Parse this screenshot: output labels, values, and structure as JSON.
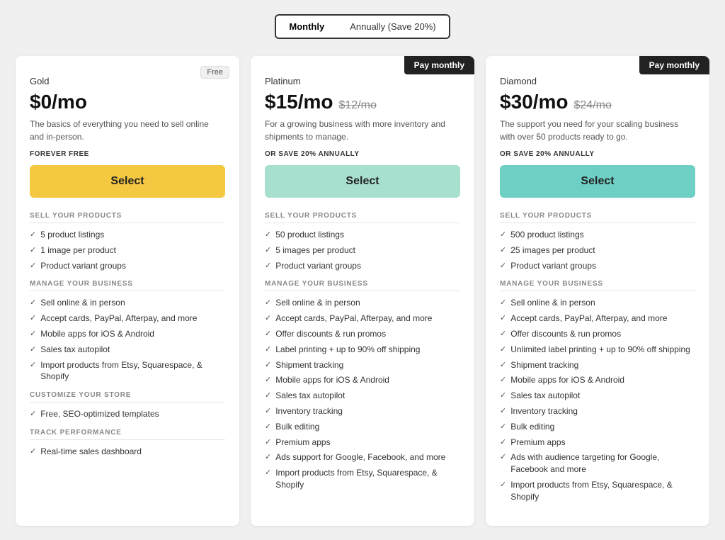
{
  "billing_toggle": {
    "monthly_label": "Monthly",
    "annually_label": "Annually (Save 20%)",
    "active": "monthly"
  },
  "plans": [
    {
      "id": "gold",
      "name": "Gold",
      "badge": "Free",
      "badge_type": "free",
      "price_main": "$0/mo",
      "price_original": null,
      "top_button": null,
      "description": "The basics of everything you need to sell online and in-person.",
      "sub_label": "FOREVER FREE",
      "select_label": "Select",
      "select_style": "gold",
      "sections": [
        {
          "title": "SELL YOUR PRODUCTS",
          "items": [
            "5 product listings",
            "1 image per product",
            "Product variant groups"
          ]
        },
        {
          "title": "MANAGE YOUR BUSINESS",
          "items": [
            "Sell online & in person",
            "Accept cards, PayPal, Afterpay, and more",
            "Mobile apps for iOS & Android",
            "Sales tax autopilot",
            "Import products from Etsy, Squarespace, & Shopify"
          ]
        },
        {
          "title": "CUSTOMIZE YOUR STORE",
          "items": [
            "Free, SEO-optimized templates"
          ]
        },
        {
          "title": "TRACK PERFORMANCE",
          "items": [
            "Real-time sales dashboard"
          ]
        }
      ]
    },
    {
      "id": "platinum",
      "name": "Platinum",
      "badge": null,
      "badge_type": null,
      "price_main": "$15/mo",
      "price_original": "$12/mo",
      "top_button": "Pay monthly",
      "description": "For a growing business with more inventory and shipments to manage.",
      "sub_label": "OR SAVE 20% ANNUALLY",
      "select_label": "Select",
      "select_style": "platinum",
      "sections": [
        {
          "title": "SELL YOUR PRODUCTS",
          "items": [
            "50 product listings",
            "5 images per product",
            "Product variant groups"
          ]
        },
        {
          "title": "MANAGE YOUR BUSINESS",
          "items": [
            "Sell online & in person",
            "Accept cards, PayPal, Afterpay, and more",
            "Offer discounts & run promos",
            "Label printing + up to 90% off shipping",
            "Shipment tracking",
            "Mobile apps for iOS & Android",
            "Sales tax autopilot",
            "Inventory tracking",
            "Bulk editing",
            "Premium apps",
            "Ads support for Google, Facebook, and more",
            "Import products from Etsy, Squarespace, & Shopify"
          ]
        }
      ]
    },
    {
      "id": "diamond",
      "name": "Diamond",
      "badge": null,
      "badge_type": null,
      "price_main": "$30/mo",
      "price_original": "$24/mo",
      "top_button": "Pay monthly",
      "description": "The support you need for your scaling business with over 50 products ready to go.",
      "sub_label": "OR SAVE 20% ANNUALLY",
      "select_label": "Select",
      "select_style": "diamond",
      "sections": [
        {
          "title": "SELL YOUR PRODUCTS",
          "items": [
            "500 product listings",
            "25 images per product",
            "Product variant groups"
          ]
        },
        {
          "title": "MANAGE YOUR BUSINESS",
          "items": [
            "Sell online & in person",
            "Accept cards, PayPal, Afterpay, and more",
            "Offer discounts & run promos",
            "Unlimited label printing + up to 90% off shipping",
            "Shipment tracking",
            "Mobile apps for iOS & Android",
            "Sales tax autopilot",
            "Inventory tracking",
            "Bulk editing",
            "Premium apps",
            "Ads with audience targeting for Google, Facebook and more",
            "Import products from Etsy, Squarespace, & Shopify"
          ]
        }
      ]
    }
  ]
}
